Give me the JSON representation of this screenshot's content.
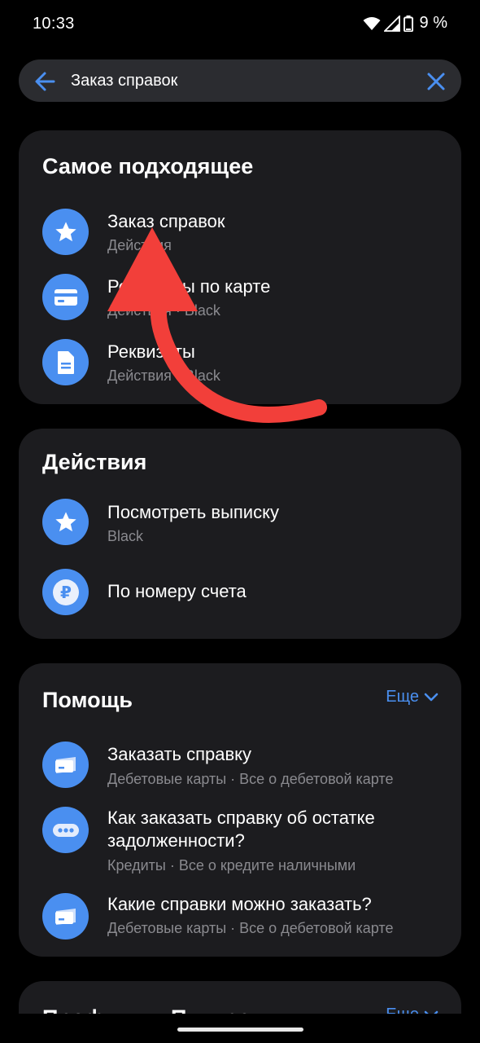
{
  "status": {
    "time": "10:33",
    "battery": "9 %"
  },
  "search": {
    "query": "Заказ справок"
  },
  "best_match": {
    "title": "Самое подходящее",
    "items": [
      {
        "title": "Заказ справок",
        "subtitle": "Действия",
        "icon": "star-icon"
      },
      {
        "title": "Реквизиты по карте",
        "subtitle": "Действия · Black",
        "icon": "card-icon"
      },
      {
        "title": "Реквизиты",
        "subtitle": "Действия · Black",
        "icon": "document-icon"
      }
    ]
  },
  "actions": {
    "title": "Действия",
    "items": [
      {
        "title": "Посмотреть выписку",
        "subtitle": "Black",
        "icon": "star-icon"
      },
      {
        "title": "По номеру счета",
        "subtitle": "",
        "icon": "ruble-icon"
      }
    ]
  },
  "help": {
    "title": "Помощь",
    "more": "Еще",
    "items": [
      {
        "title": "Заказать справку",
        "subtitle": "Дебетовые карты · Все о дебетовой карте",
        "icon": "card-icon"
      },
      {
        "title_line1": "Как заказать справку об остатке",
        "title_line2": "задолженности?",
        "subtitle": "Кредиты · Все о кредите наличными",
        "icon": "chat-icon"
      },
      {
        "title": "Какие справки можно заказать?",
        "subtitle": "Дебетовые карты · Все о дебетовой карте",
        "icon": "card-icon"
      }
    ]
  },
  "profiles": {
    "title": "Профили в Пульсе",
    "more": "Еще"
  },
  "colors": {
    "accent": "#4a8ff0",
    "card_bg": "#1c1c1f",
    "overlay_arrow": "#f23f3a"
  }
}
